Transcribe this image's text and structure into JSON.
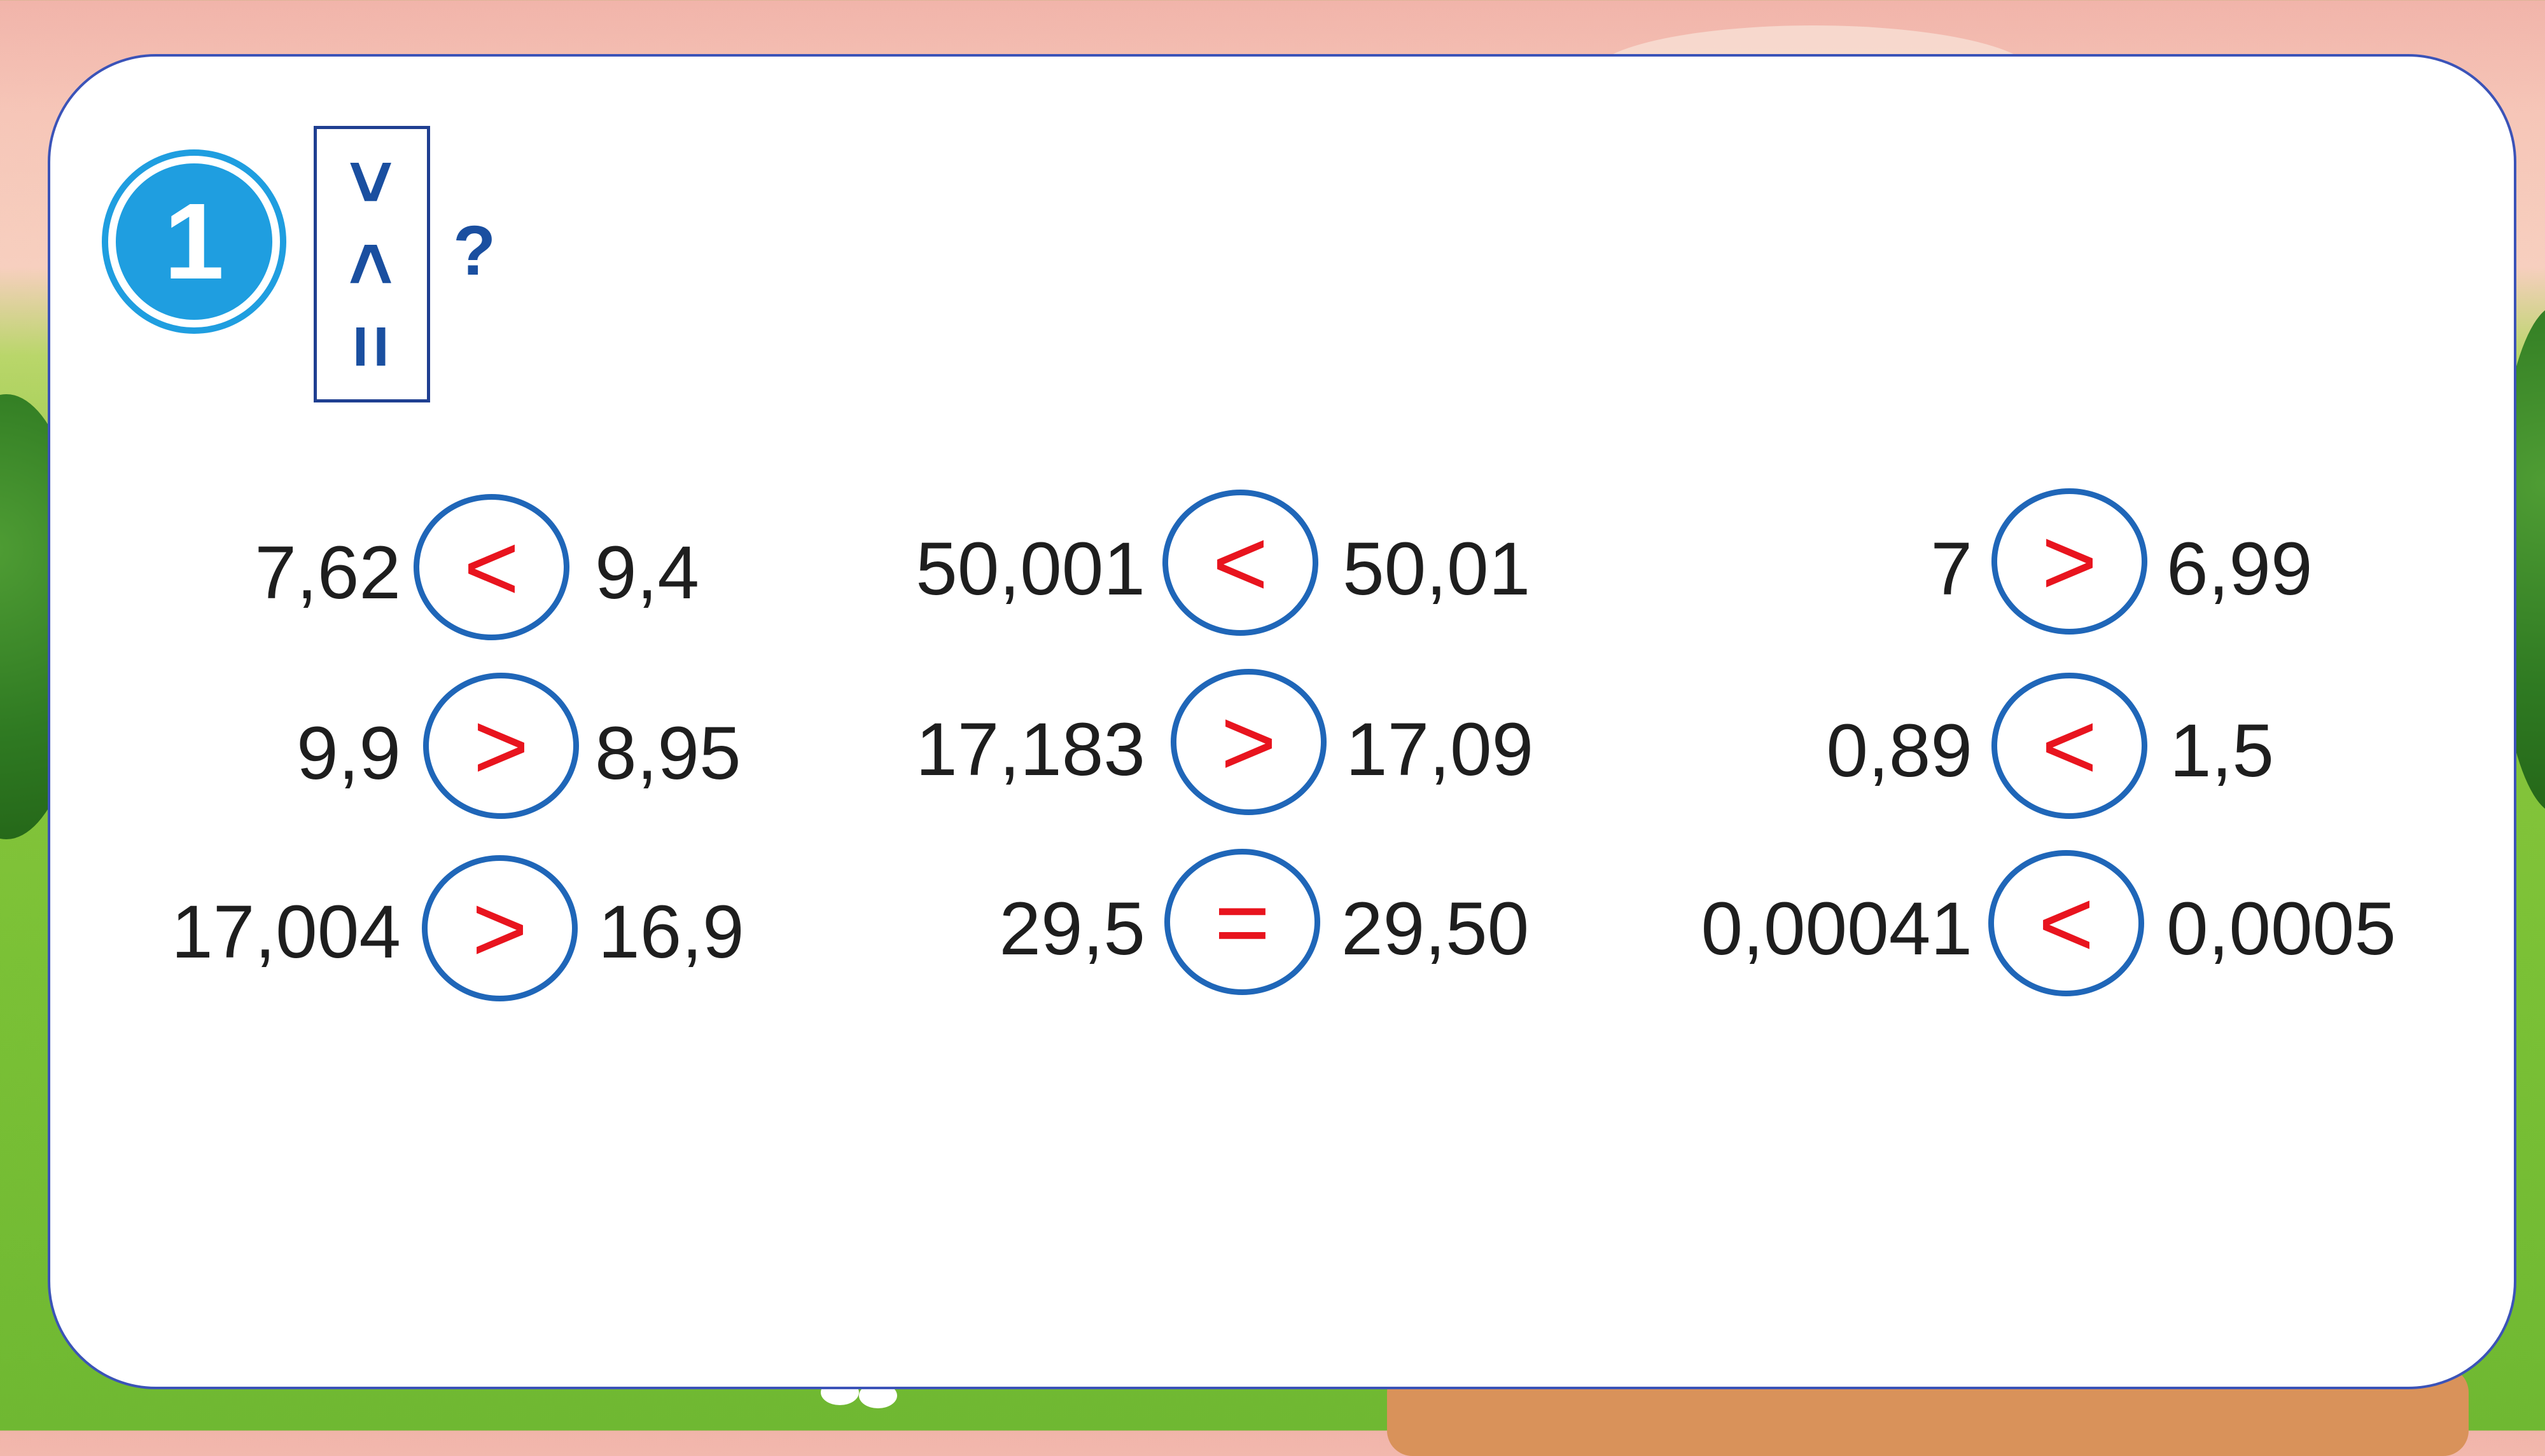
{
  "exercise": {
    "number": "1",
    "symbols": [
      ">",
      "<",
      "="
    ],
    "question_mark": "?"
  },
  "rows": [
    [
      {
        "left": "7,62",
        "sign": "<",
        "right": "9,4"
      },
      {
        "left": "50,001",
        "sign": "<",
        "right": "50,01"
      },
      {
        "left": "7",
        "sign": ">",
        "right": "6,99"
      }
    ],
    [
      {
        "left": "9,9",
        "sign": ">",
        "right": "8,95"
      },
      {
        "left": "17,183",
        "sign": ">",
        "right": "17,09"
      },
      {
        "left": "0,89",
        "sign": "<",
        "right": "1,5"
      }
    ],
    [
      {
        "left": "17,004",
        "sign": ">",
        "right": "16,9"
      },
      {
        "left": "29,5",
        "sign": "=",
        "right": "29,50"
      },
      {
        "left": "0,00041",
        "sign": "<",
        "right": "0,0005"
      }
    ]
  ],
  "colors": {
    "badge": "#1f9ee0",
    "circle_border": "#1f66b8",
    "answer_sign": "#e8141e",
    "symbol_box": "#1a4fa0"
  }
}
